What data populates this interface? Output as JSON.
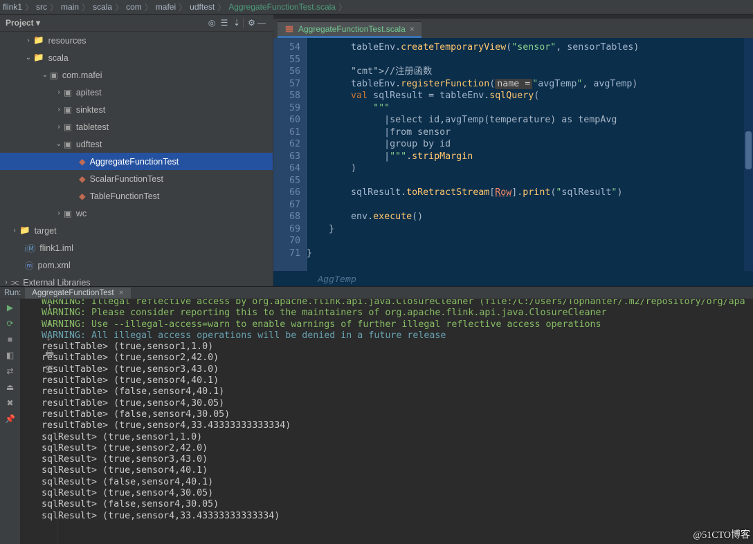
{
  "breadcrumb": [
    "flink1",
    "src",
    "main",
    "scala",
    "com",
    "mafei",
    "udftest",
    "AggregateFunctionTest.scala"
  ],
  "project": {
    "title": "Project ▾",
    "tree": [
      {
        "ind": 34,
        "arrow": "›",
        "icon": "dir",
        "name": "resources"
      },
      {
        "ind": 34,
        "arrow": "⌄",
        "icon": "dir",
        "name": "scala"
      },
      {
        "ind": 58,
        "arrow": "⌄",
        "icon": "pkg",
        "name": "com.mafei"
      },
      {
        "ind": 78,
        "arrow": "›",
        "icon": "pkg",
        "name": "apitest"
      },
      {
        "ind": 78,
        "arrow": "›",
        "icon": "pkg",
        "name": "sinktest"
      },
      {
        "ind": 78,
        "arrow": "›",
        "icon": "pkg",
        "name": "tabletest"
      },
      {
        "ind": 78,
        "arrow": "⌄",
        "icon": "pkg",
        "name": "udftest"
      },
      {
        "ind": 100,
        "arrow": "",
        "icon": "cls",
        "name": "AggregateFunctionTest",
        "sel": true
      },
      {
        "ind": 100,
        "arrow": "",
        "icon": "cls",
        "name": "ScalarFunctionTest"
      },
      {
        "ind": 100,
        "arrow": "",
        "icon": "cls",
        "name": "TableFunctionTest"
      },
      {
        "ind": 78,
        "arrow": "›",
        "icon": "pkg",
        "name": "wc"
      },
      {
        "ind": 14,
        "arrow": "›",
        "icon": "src",
        "name": "target"
      },
      {
        "ind": 22,
        "arrow": "",
        "icon": "iml",
        "name": "flink1.iml"
      },
      {
        "ind": 22,
        "arrow": "",
        "icon": "pom",
        "name": "pom.xml"
      },
      {
        "ind": 2,
        "arrow": "›",
        "icon": "lib",
        "name": "External Libraries"
      }
    ]
  },
  "tabs": {
    "open": "AggregateFunctionTest.scala"
  },
  "editor": {
    "firstLine": 54,
    "lines": [
      "        tableEnv.createTemporaryView(\"sensor\", sensorTables)",
      "",
      "        //注册函数",
      "        tableEnv.registerFunction(name = \"avgTemp\", avgTemp)",
      "        val sqlResult = tableEnv.sqlQuery(",
      "            \"\"\"",
      "              |select id,avgTemp(temperature) as tempAvg",
      "              |from sensor",
      "              |group by id",
      "              |\"\"\".stripMargin",
      "        )",
      "",
      "        sqlResult.toRetractStream[Row].print(\"sqlResult\")",
      "",
      "        env.execute()",
      "    }",
      "",
      "}"
    ],
    "hint": "AggTemp"
  },
  "run": {
    "label": "Run:",
    "tab": "AggregateFunctionTest",
    "lines": [
      {
        "c": "warn1",
        "t": "WARNING: Illegal reflective access by org.apache.flink.api.java.ClosureCleaner (file:/C:/Users/Tophanter/.m2/repository/org/apa"
      },
      {
        "c": "warn1",
        "t": "WARNING: Please consider reporting this to the maintainers of org.apache.flink.api.java.ClosureCleaner"
      },
      {
        "c": "warn1",
        "t": "WARNING: Use --illegal-access=warn to enable warnings of further illegal reflective access operations"
      },
      {
        "c": "warn2",
        "t": "WARNING: All illegal access operations will be denied in a future release"
      },
      {
        "c": "",
        "t": "resultTable> (true,sensor1,1.0)"
      },
      {
        "c": "",
        "t": "resultTable> (true,sensor2,42.0)"
      },
      {
        "c": "",
        "t": "resultTable> (true,sensor3,43.0)"
      },
      {
        "c": "",
        "t": "resultTable> (true,sensor4,40.1)"
      },
      {
        "c": "",
        "t": "resultTable> (false,sensor4,40.1)"
      },
      {
        "c": "",
        "t": "resultTable> (true,sensor4,30.05)"
      },
      {
        "c": "",
        "t": "resultTable> (false,sensor4,30.05)"
      },
      {
        "c": "",
        "t": "resultTable> (true,sensor4,33.43333333333334)"
      },
      {
        "c": "",
        "t": "sqlResult> (true,sensor1,1.0)"
      },
      {
        "c": "",
        "t": "sqlResult> (true,sensor2,42.0)"
      },
      {
        "c": "",
        "t": "sqlResult> (true,sensor3,43.0)"
      },
      {
        "c": "",
        "t": "sqlResult> (true,sensor4,40.1)"
      },
      {
        "c": "",
        "t": "sqlResult> (false,sensor4,40.1)"
      },
      {
        "c": "",
        "t": "sqlResult> (true,sensor4,30.05)"
      },
      {
        "c": "",
        "t": "sqlResult> (false,sensor4,30.05)"
      },
      {
        "c": "",
        "t": "sqlResult> (true,sensor4,33.43333333333334)"
      }
    ]
  },
  "watermark": "@51CTO博客",
  "icons": {
    "target": "◎",
    "flatten": "☰",
    "scroll": "⇣",
    "gear": "⚙",
    "collapse": "—",
    "run": "▶",
    "stop": "■",
    "rerun": "↻",
    "down": "↓",
    "up": "↑",
    "trash": "🗑",
    "wrap": "↩",
    "print": "🖶",
    "cam": "📷",
    "pin": "📌",
    "struct": "▤"
  }
}
